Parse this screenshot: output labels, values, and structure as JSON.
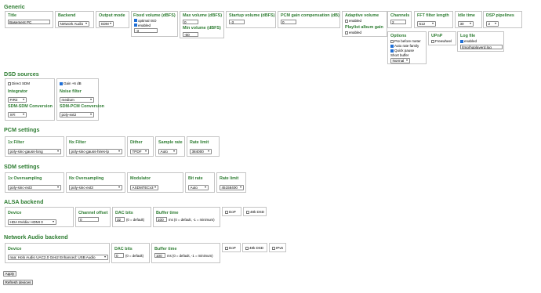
{
  "sections": {
    "generic": "Generic",
    "dsd": "DSD sources",
    "pcm": "PCM settings",
    "sdm": "SDM settings",
    "alsa": "ALSA backend",
    "na": "Network Audio backend"
  },
  "generic": {
    "title_label": "Title",
    "title_value": "Basement PC",
    "backend_label": "Backend",
    "backend_value": "Network Audio",
    "output_mode_label": "Output mode",
    "output_mode_value": "SDM",
    "fixed_volume_label": "Fixed volume (dBFS)",
    "optimal_iso_label": "optimal ISO",
    "enabled_label": "enabled",
    "fixed_volume_value": "-3",
    "max_volume_label": "Max volume (dBFS)",
    "max_volume_value": "0",
    "min_volume_label": "Min volume (dBFS)",
    "min_volume_value": "-60",
    "startup_volume_label": "Startup volume (dBFS)",
    "startup_volume_value": "-3",
    "pcm_gain_label": "PCM gain compensation (dB)",
    "pcm_gain_value": "0",
    "adaptive_volume_label": "Adaptive volume",
    "adaptive_enabled_label": "enabled",
    "playlist_gain_label": "Playlist album gain",
    "playlist_enabled_label": "enabled",
    "channels_label": "Channels",
    "channels_value": "2",
    "fft_label": "FFT filter length",
    "fft_value": "512",
    "idle_label": "Idle time",
    "idle_value": "30",
    "dsp_label": "DSP pipelines",
    "dsp_value": "2",
    "options_label": "Options",
    "opt_pre": "Pre before meter",
    "opt_rate": "Auto rate family",
    "opt_quick": "Quick pause",
    "short_buffer_label": "Short buffer",
    "short_buffer_value": "Normal",
    "upnp_label": "UPnP",
    "freewheel_label": "Freewheel",
    "logfile_label": "Log file",
    "log_enabled_label": "enabled",
    "log_path": "/tmp/hqplayerd.log"
  },
  "dsd": {
    "direct_sdm": "Direct SDM",
    "gain": "Gain +6 dB",
    "integrator_label": "Integrator",
    "integrator_value": "FIR2",
    "noise_label": "Noise filter",
    "noise_value": "medium",
    "sdm_conv_label": "SDM-SDM Conversion",
    "sdm_conv_value": "XFi",
    "pcm_conv_label": "SDM-PCM Conversion",
    "pcm_conv_value": "poly-ext2"
  },
  "pcm": {
    "f1_label": "1x Filter",
    "f1_value": "poly-sinc-gauss-long",
    "nx_label": "Nx Filter",
    "nx_value": "poly-sinc-gauss-hires-lp",
    "dither_label": "Dither",
    "dither_value": "TPDF",
    "rate_label": "Sample rate",
    "rate_value": "Auto",
    "limit_label": "Rate limit",
    "limit_value": "384000"
  },
  "sdm": {
    "os1_label": "1x Oversampling",
    "os1_value": "poly-sinc-ext3",
    "osn_label": "Nx Oversampling",
    "osn_value": "poly-sinc-ext3",
    "mod_label": "Modulator",
    "mod_value": "ASDM7ECv3",
    "bit_label": "Bit rate",
    "bit_value": "Auto",
    "limit_label": "Rate limit",
    "limit_value": "45158400"
  },
  "alsa": {
    "device_label": "Device",
    "device_value": "HDA NVidia: HDMI 0",
    "offset_label": "Channel offset",
    "offset_value": "0",
    "dac_label": "DAC bits",
    "dac_value": "32",
    "dac_hint": "(0 = default)",
    "buffer_label": "Buffer time",
    "buffer_value": "100",
    "buffer_hint": "ms (0 = default, -1 = minimum)",
    "dop_label": "DoP",
    "dsd48_label": "48k DSD"
  },
  "na": {
    "device_label": "Device",
    "device_value": "naa: Holo Audio UAC2.0 Gen2 Enhanced: USB Audio",
    "dac_label": "DAC bits",
    "dac_value": "0",
    "dac_hint": "(0 = default)",
    "buffer_label": "Buffer time",
    "buffer_value": "100",
    "buffer_hint": "ms (0 = default, -1 = minimum)",
    "dop_label": "DoP",
    "dsd48_label": "48k DSD",
    "ipv6_label": "IPv6"
  },
  "buttons": {
    "apply": "Apply",
    "refresh": "Refresh devices"
  },
  "icons": {
    "select_arrow": "chevron-down-icon",
    "checkbox_checked": "check-icon"
  },
  "colors": {
    "heading": "#2e7d32",
    "checkbox": "#1f6fd6",
    "border": "#c4c4c4"
  }
}
